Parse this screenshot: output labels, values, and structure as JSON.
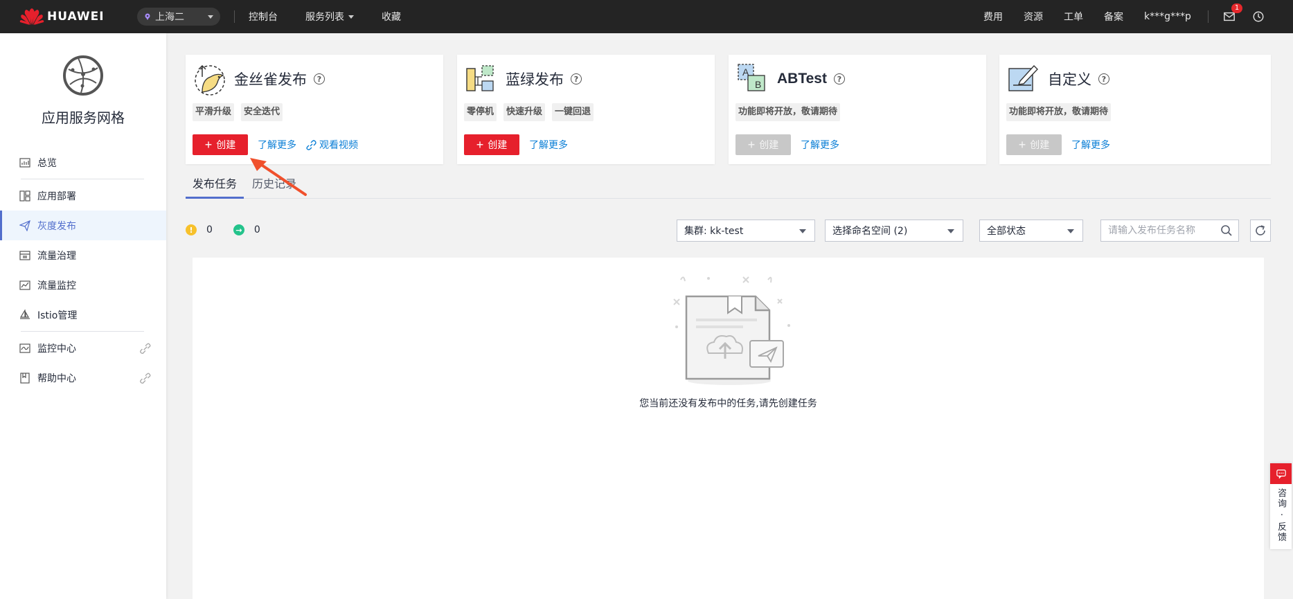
{
  "topbar": {
    "brand": "HUAWEI",
    "region": "上海二",
    "nav": [
      "控制台",
      "服务列表",
      "收藏"
    ],
    "right_links": [
      "费用",
      "资源",
      "工单",
      "备案"
    ],
    "user": "k***g***p",
    "message_badge": "1"
  },
  "sidebar": {
    "service_title": "应用服务网格",
    "items": [
      {
        "label": "总览"
      },
      {
        "label": "应用部署"
      },
      {
        "label": "灰度发布"
      },
      {
        "label": "流量治理"
      },
      {
        "label": "流量监控"
      },
      {
        "label": "Istio管理"
      },
      {
        "label": "监控中心"
      },
      {
        "label": "帮助中心"
      }
    ]
  },
  "cards": [
    {
      "title": "金丝雀发布",
      "tags": [
        "平滑升级",
        "安全迭代"
      ],
      "create": "创建",
      "learn_more": "了解更多",
      "video": "观看视频"
    },
    {
      "title": "蓝绿发布",
      "tags": [
        "零停机",
        "快速升级",
        "一键回退"
      ],
      "create": "创建",
      "learn_more": "了解更多"
    },
    {
      "title": "ABTest",
      "tags": [
        "功能即将开放，敬请期待"
      ],
      "create": "创建",
      "learn_more": "了解更多"
    },
    {
      "title": "自定义",
      "tags": [
        "功能即将开放，敬请期待"
      ],
      "create": "创建",
      "learn_more": "了解更多"
    }
  ],
  "tabs": [
    "发布任务",
    "历史记录"
  ],
  "status": {
    "warning_count": "0",
    "running_count": "0"
  },
  "filters": {
    "cluster": "集群:  kk-test",
    "namespace": "选择命名空间 (2)",
    "state": "全部状态",
    "search_placeholder": "请输入发布任务名称"
  },
  "empty": {
    "message": "您当前还没有发布中的任务,请先创建任务"
  },
  "feedback": {
    "label": "咨询 · 反馈"
  },
  "colors": {
    "primary_red": "#e6202c",
    "link_blue": "#0a7ed6",
    "active_blue": "#526ecc"
  }
}
